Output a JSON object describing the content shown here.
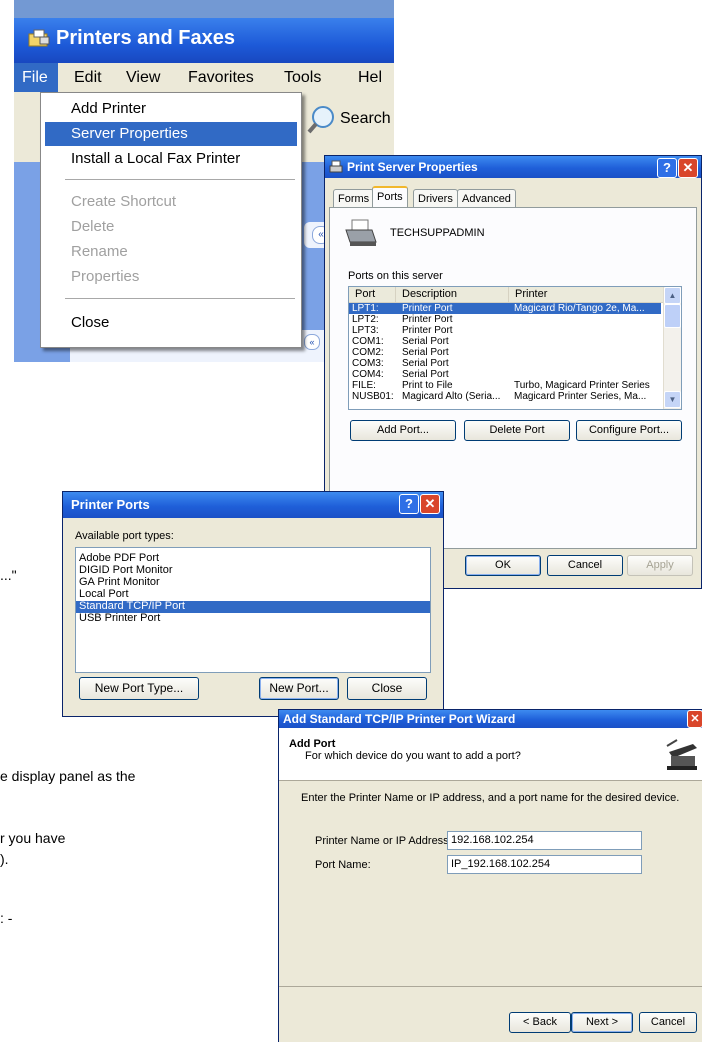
{
  "doc_fragments": {
    "frag1": "...\"",
    "frag2": "e display panel as the",
    "frag3": "r you have",
    "frag4": ").",
    "frag5": ": -"
  },
  "explorer": {
    "title": "Printers and Faxes",
    "menu": {
      "file": "File",
      "edit": "Edit",
      "view": "View",
      "favorites": "Favorites",
      "tools": "Tools",
      "help": "Hel"
    },
    "search_label": "Search",
    "file_menu": {
      "add_printer": "Add Printer",
      "server_properties": "Server Properties",
      "install_fax": "Install a Local Fax Printer",
      "create_shortcut": "Create Shortcut",
      "delete": "Delete",
      "rename": "Rename",
      "properties": "Properties",
      "close": "Close"
    }
  },
  "print_server": {
    "title": "Print Server Properties",
    "tabs": [
      "Forms",
      "Ports",
      "Drivers",
      "Advanced"
    ],
    "active_tab": "Ports",
    "server_name": "TECHSUPPADMIN",
    "ports_label": "Ports on this server",
    "columns": [
      "Port",
      "Description",
      "Printer"
    ],
    "rows": [
      {
        "port": "LPT1:",
        "desc": "Printer Port",
        "printer": "Magicard Rio/Tango 2e, Ma..."
      },
      {
        "port": "LPT2:",
        "desc": "Printer Port",
        "printer": ""
      },
      {
        "port": "LPT3:",
        "desc": "Printer Port",
        "printer": ""
      },
      {
        "port": "COM1:",
        "desc": "Serial Port",
        "printer": ""
      },
      {
        "port": "COM2:",
        "desc": "Serial Port",
        "printer": ""
      },
      {
        "port": "COM3:",
        "desc": "Serial Port",
        "printer": ""
      },
      {
        "port": "COM4:",
        "desc": "Serial Port",
        "printer": ""
      },
      {
        "port": "FILE:",
        "desc": "Print to File",
        "printer": "Turbo, Magicard Printer Series"
      },
      {
        "port": "NUSB01:",
        "desc": "Magicard Alto (Seria...",
        "printer": "Magicard Printer Series, Ma..."
      }
    ],
    "buttons": {
      "add_port": "Add Port...",
      "delete_port": "Delete Port",
      "configure_port": "Configure Port...",
      "ok": "OK",
      "cancel": "Cancel",
      "apply": "Apply"
    }
  },
  "printer_ports": {
    "title": "Printer Ports",
    "label": "Available port types:",
    "items": [
      "Adobe PDF Port",
      "DIGID Port Monitor",
      "GA Print Monitor",
      "Local Port",
      "Standard TCP/IP Port",
      "USB Printer Port"
    ],
    "selected": "Standard TCP/IP Port",
    "buttons": {
      "new_type": "New Port Type...",
      "new_port": "New Port...",
      "close": "Close"
    }
  },
  "wizard": {
    "title": "Add Standard TCP/IP Printer Port Wizard",
    "heading": "Add Port",
    "subheading": "For which device do you want to add a port?",
    "instruction": "Enter the Printer Name or IP address, and a port name for the desired device.",
    "ip_label": "Printer Name or IP Address:",
    "ip_value": "192.168.102.254",
    "port_label": "Port Name:",
    "port_value": "IP_192.168.102.254",
    "buttons": {
      "back": "< Back",
      "next": "Next >",
      "cancel": "Cancel"
    }
  },
  "colors": {
    "xp_blue": "#1f5fd9",
    "selection": "#316ac5",
    "window_bg": "#ece9d8"
  }
}
